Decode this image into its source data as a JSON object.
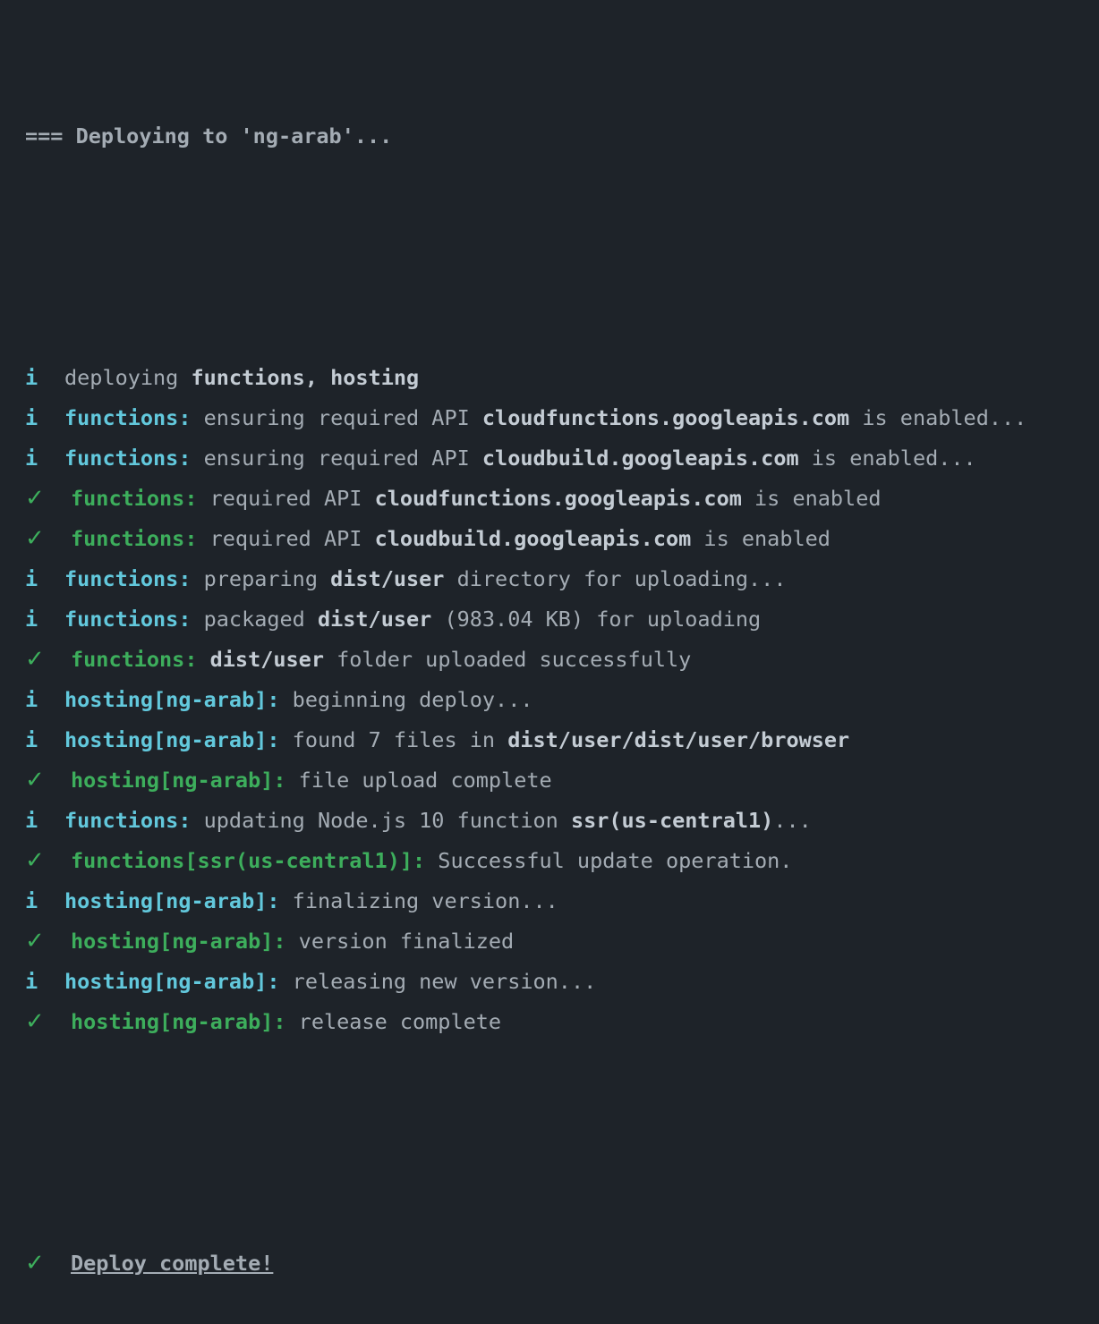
{
  "header": "=== Deploying to 'ng-arab'...",
  "icons": {
    "info": "i",
    "check": "✓",
    "info_name": "info-icon",
    "check_name": "checkmark-icon"
  },
  "colors": {
    "background": "#1e2329",
    "text": "#a4acb4",
    "info": "#62c8dc",
    "success": "#3dae5c"
  },
  "lines": [
    {
      "type": "info",
      "parts": [
        {
          "t": "deploying ",
          "s": "n"
        },
        {
          "t": "functions, hosting",
          "s": "b"
        }
      ]
    },
    {
      "type": "info",
      "parts": [
        {
          "t": "functions:",
          "s": "tag"
        },
        {
          "t": " ensuring required API ",
          "s": "n"
        },
        {
          "t": "cloudfunctions.googleapis.com",
          "s": "b"
        },
        {
          "t": " is enabled...",
          "s": "n"
        }
      ]
    },
    {
      "type": "info",
      "parts": [
        {
          "t": "functions:",
          "s": "tag"
        },
        {
          "t": " ensuring required API ",
          "s": "n"
        },
        {
          "t": "cloudbuild.googleapis.com",
          "s": "b"
        },
        {
          "t": " is enabled...",
          "s": "n"
        }
      ]
    },
    {
      "type": "ok",
      "parts": [
        {
          "t": "functions:",
          "s": "tag"
        },
        {
          "t": " required API ",
          "s": "n"
        },
        {
          "t": "cloudfunctions.googleapis.com",
          "s": "b"
        },
        {
          "t": " is enabled",
          "s": "n"
        }
      ]
    },
    {
      "type": "ok",
      "parts": [
        {
          "t": "functions:",
          "s": "tag"
        },
        {
          "t": " required API ",
          "s": "n"
        },
        {
          "t": "cloudbuild.googleapis.com",
          "s": "b"
        },
        {
          "t": " is enabled",
          "s": "n"
        }
      ]
    },
    {
      "type": "info",
      "parts": [
        {
          "t": "functions:",
          "s": "tag"
        },
        {
          "t": " preparing ",
          "s": "n"
        },
        {
          "t": "dist/user",
          "s": "b"
        },
        {
          "t": " directory for uploading...",
          "s": "n"
        }
      ]
    },
    {
      "type": "info",
      "parts": [
        {
          "t": "functions:",
          "s": "tag"
        },
        {
          "t": " packaged ",
          "s": "n"
        },
        {
          "t": "dist/user",
          "s": "b"
        },
        {
          "t": " (983.04 KB) for uploading",
          "s": "n"
        }
      ]
    },
    {
      "type": "ok",
      "parts": [
        {
          "t": "functions:",
          "s": "tag"
        },
        {
          "t": " ",
          "s": "n"
        },
        {
          "t": "dist/user",
          "s": "b"
        },
        {
          "t": " folder uploaded successfully",
          "s": "n"
        }
      ]
    },
    {
      "type": "info",
      "parts": [
        {
          "t": "hosting[ng-arab]:",
          "s": "tag"
        },
        {
          "t": " beginning deploy...",
          "s": "n"
        }
      ]
    },
    {
      "type": "info",
      "parts": [
        {
          "t": "hosting[ng-arab]:",
          "s": "tag"
        },
        {
          "t": " found 7 files in ",
          "s": "n"
        },
        {
          "t": "dist/user/dist/user/browser",
          "s": "b"
        }
      ]
    },
    {
      "type": "ok",
      "parts": [
        {
          "t": "hosting[ng-arab]:",
          "s": "tag"
        },
        {
          "t": " file upload complete",
          "s": "n"
        }
      ]
    },
    {
      "type": "info",
      "parts": [
        {
          "t": "functions:",
          "s": "tag"
        },
        {
          "t": " updating Node.js 10 function ",
          "s": "n"
        },
        {
          "t": "ssr(us-central1)",
          "s": "b"
        },
        {
          "t": "...",
          "s": "n"
        }
      ]
    },
    {
      "type": "ok",
      "parts": [
        {
          "t": "functions[ssr(us-central1)]:",
          "s": "tag"
        },
        {
          "t": " Successful update operation.",
          "s": "n"
        }
      ]
    },
    {
      "type": "info",
      "parts": [
        {
          "t": "hosting[ng-arab]:",
          "s": "tag"
        },
        {
          "t": " finalizing version...",
          "s": "n"
        }
      ]
    },
    {
      "type": "ok",
      "parts": [
        {
          "t": "hosting[ng-arab]:",
          "s": "tag"
        },
        {
          "t": " version finalized",
          "s": "n"
        }
      ]
    },
    {
      "type": "info",
      "parts": [
        {
          "t": "hosting[ng-arab]:",
          "s": "tag"
        },
        {
          "t": " releasing new version...",
          "s": "n"
        }
      ]
    },
    {
      "type": "ok",
      "parts": [
        {
          "t": "hosting[ng-arab]:",
          "s": "tag"
        },
        {
          "t": " release complete",
          "s": "n"
        }
      ]
    }
  ],
  "final": {
    "icon": "✓",
    "text": "Deploy complete!"
  }
}
